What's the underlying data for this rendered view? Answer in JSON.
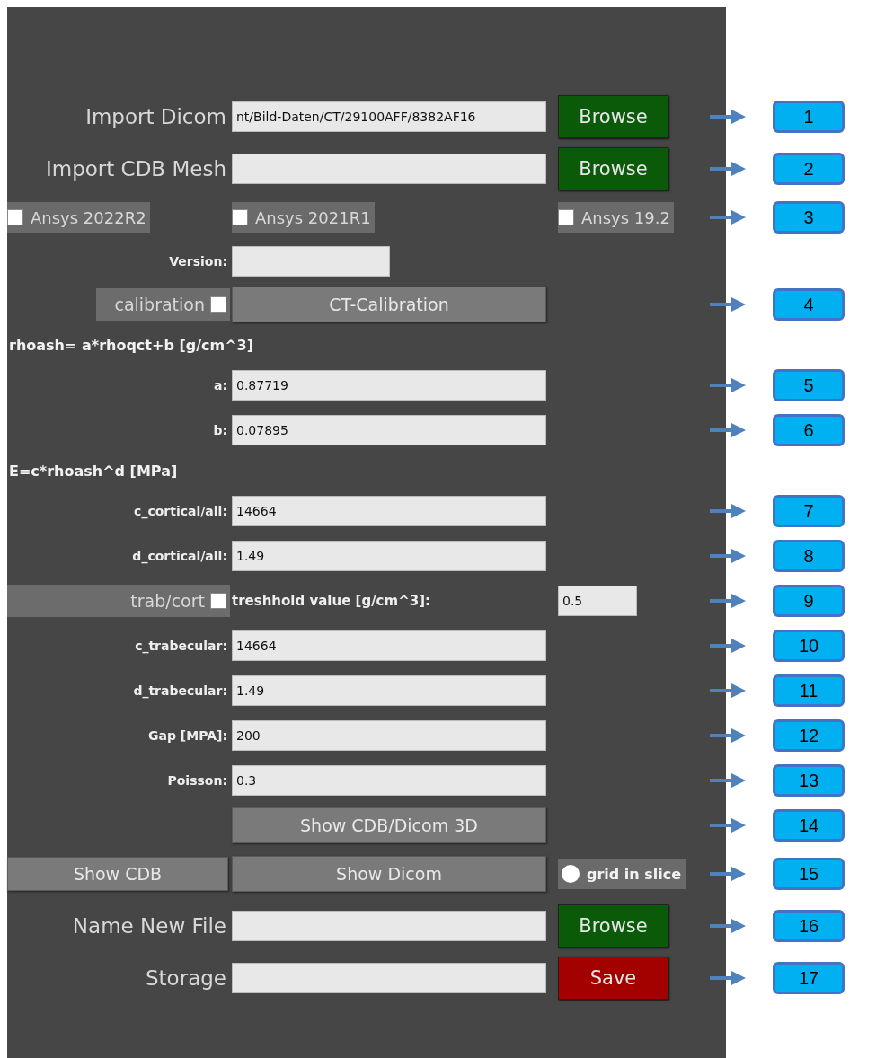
{
  "rows": [
    {
      "kind": "file",
      "label": "Import Dicom",
      "value": "nt/Bild-Daten/CT/29100AFF/8382AF16",
      "button": {
        "label": "Browse",
        "kind": "browse"
      },
      "callout": "1"
    },
    {
      "kind": "file",
      "label": "Import CDB Mesh",
      "button": {
        "label": "Browse",
        "kind": "browse"
      },
      "callout": "2"
    },
    {
      "kind": "checkboxes",
      "items": [
        {
          "label": "Ansys 2022R2",
          "checked": false
        },
        {
          "label": "Ansys 2021R1",
          "checked": false
        },
        {
          "label": "Ansys 19.2",
          "checked": false
        }
      ],
      "callout": "3"
    },
    {
      "kind": "short_field",
      "label": "Version:"
    },
    {
      "kind": "calibration",
      "toggle": {
        "label": "calibration",
        "checked": false
      },
      "button": "CT-Calibration",
      "callout": "4"
    },
    {
      "kind": "heading",
      "text": "rhoash= a*rhoqct+b [g/cm^3]"
    },
    {
      "kind": "field",
      "label": "a:",
      "value": "0.87719",
      "callout": "5"
    },
    {
      "kind": "field",
      "label": "b:",
      "value": "0.07895",
      "callout": "6"
    },
    {
      "kind": "heading",
      "text": "E=c*rhoash^d [MPa]"
    },
    {
      "kind": "field",
      "label": "c_cortical/all:",
      "value": "14664",
      "callout": "7"
    },
    {
      "kind": "field",
      "label": "d_cortical/all:",
      "value": "1.49",
      "callout": "8"
    },
    {
      "kind": "threshold",
      "toggle": {
        "label": "trab/cort",
        "checked": false
      },
      "label": "treshhold value [g/cm^3]:",
      "value": "0.5",
      "callout": "9"
    },
    {
      "kind": "field",
      "label": "c_trabecular:",
      "value": "14664",
      "callout": "10"
    },
    {
      "kind": "field",
      "label": "d_trabecular:",
      "value": "1.49",
      "callout": "11"
    },
    {
      "kind": "field",
      "label": "Gap [MPA]:",
      "value": "200",
      "callout": "12"
    },
    {
      "kind": "field",
      "label": "Poisson:",
      "value": "0.3",
      "callout": "13"
    },
    {
      "kind": "button",
      "label": "Show CDB/Dicom 3D",
      "callout": "14"
    },
    {
      "kind": "show",
      "buttons": [
        "Show CDB",
        "Show Dicom"
      ],
      "radio": {
        "label": "grid in slice",
        "selected": false
      },
      "callout": "15"
    },
    {
      "kind": "file",
      "label": "Name New File",
      "button": {
        "label": "Browse",
        "kind": "browse"
      },
      "callout": "16"
    },
    {
      "kind": "file",
      "label": "Storage",
      "button": {
        "label": "Save",
        "kind": "save"
      },
      "callout": "17"
    }
  ]
}
